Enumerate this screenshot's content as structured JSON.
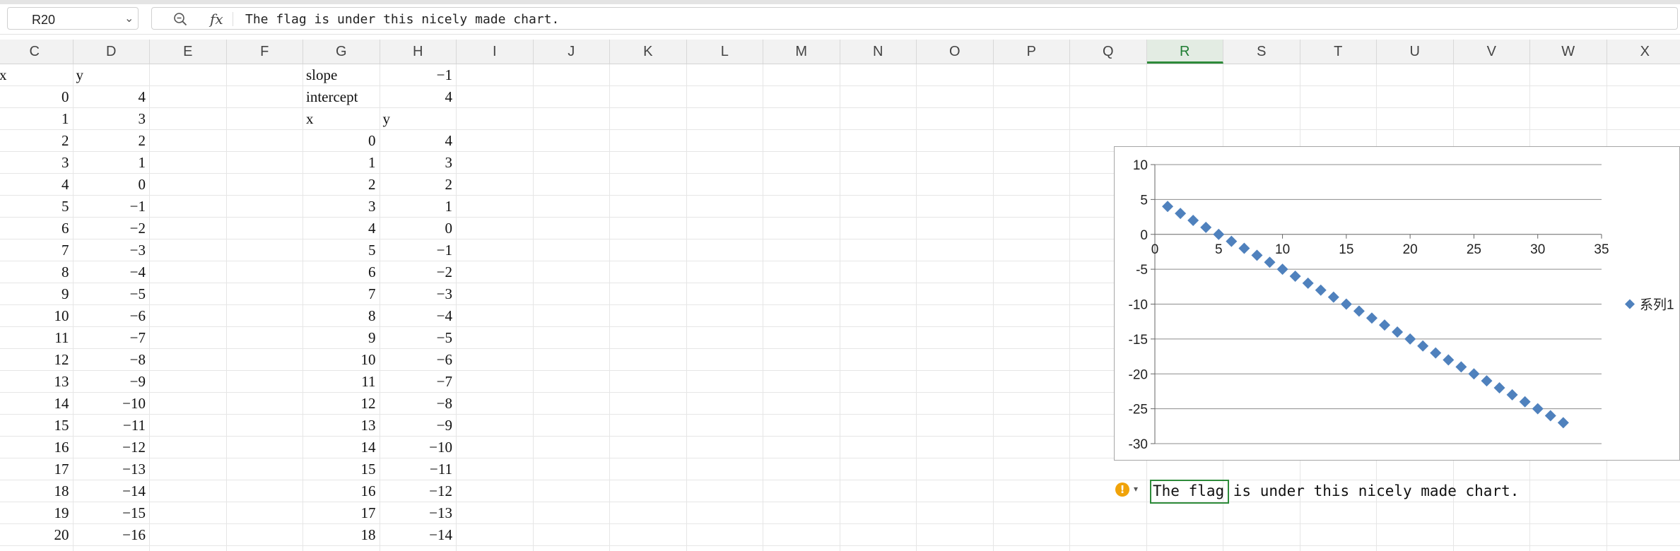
{
  "name_box": {
    "cell_ref": "R20"
  },
  "formula_bar": {
    "fx_label": "fx",
    "content": "The flag is under this nicely made chart."
  },
  "columns": [
    "C",
    "D",
    "E",
    "F",
    "G",
    "H",
    "I",
    "J",
    "K",
    "L",
    "M",
    "N",
    "O",
    "P",
    "Q",
    "R",
    "S",
    "T",
    "U",
    "V",
    "W",
    "X"
  ],
  "active_column": "R",
  "data_table_1": {
    "header_x": "x",
    "header_y": "y",
    "x": [
      "0",
      "1",
      "2",
      "3",
      "4",
      "5",
      "6",
      "7",
      "8",
      "9",
      "10",
      "11",
      "12",
      "13",
      "14",
      "15",
      "16",
      "17",
      "18",
      "19",
      "20"
    ],
    "y": [
      "4",
      "3",
      "2",
      "1",
      "0",
      "−1",
      "−2",
      "−3",
      "−4",
      "−5",
      "−6",
      "−7",
      "−8",
      "−9",
      "−10",
      "−11",
      "−12",
      "−13",
      "−14",
      "−15",
      "−16"
    ]
  },
  "data_table_2": {
    "slope_label": "slope",
    "slope_value": "−1",
    "intercept_label": "intercept",
    "intercept_value": "4",
    "header_x": "x",
    "header_y": "y",
    "x": [
      "0",
      "1",
      "2",
      "3",
      "4",
      "5",
      "6",
      "7",
      "8",
      "9",
      "10",
      "11",
      "12",
      "13",
      "14",
      "15",
      "16",
      "17",
      "18"
    ],
    "y": [
      "4",
      "3",
      "2",
      "1",
      "0",
      "−1",
      "−2",
      "−3",
      "−4",
      "−5",
      "−6",
      "−7",
      "−8",
      "−9",
      "−10",
      "−11",
      "−12",
      "−13",
      "−14"
    ]
  },
  "chart_data": {
    "type": "scatter",
    "title": "",
    "xlabel": "",
    "ylabel": "",
    "xlim": [
      0,
      35
    ],
    "ylim": [
      -30,
      10
    ],
    "x_ticks": [
      "0",
      "5",
      "10",
      "15",
      "20",
      "25",
      "30",
      "35"
    ],
    "y_ticks": [
      "10",
      "5",
      "0",
      "-5",
      "-10",
      "-15",
      "-20",
      "-25",
      "-30"
    ],
    "grid": "horizontal",
    "legend": "right",
    "series": [
      {
        "name": "系列1",
        "color": "#4f81bd",
        "marker": "diamond",
        "x": [
          1,
          2,
          3,
          4,
          5,
          6,
          7,
          8,
          9,
          10,
          11,
          12,
          13,
          14,
          15,
          16,
          17,
          18,
          19,
          20,
          21,
          22,
          23,
          24,
          25,
          26,
          27,
          28,
          29,
          30,
          31,
          32
        ],
        "y": [
          4,
          3,
          2,
          1,
          0,
          -1,
          -2,
          -3,
          -4,
          -5,
          -6,
          -7,
          -8,
          -9,
          -10,
          -11,
          -12,
          -13,
          -14,
          -15,
          -16,
          -17,
          -18,
          -19,
          -20,
          -21,
          -22,
          -23,
          -24,
          -25,
          -26,
          -27
        ]
      }
    ]
  },
  "message_cell": {
    "text": "The flag is under this nicely made chart.",
    "warning_icon": "exclamation-icon"
  }
}
